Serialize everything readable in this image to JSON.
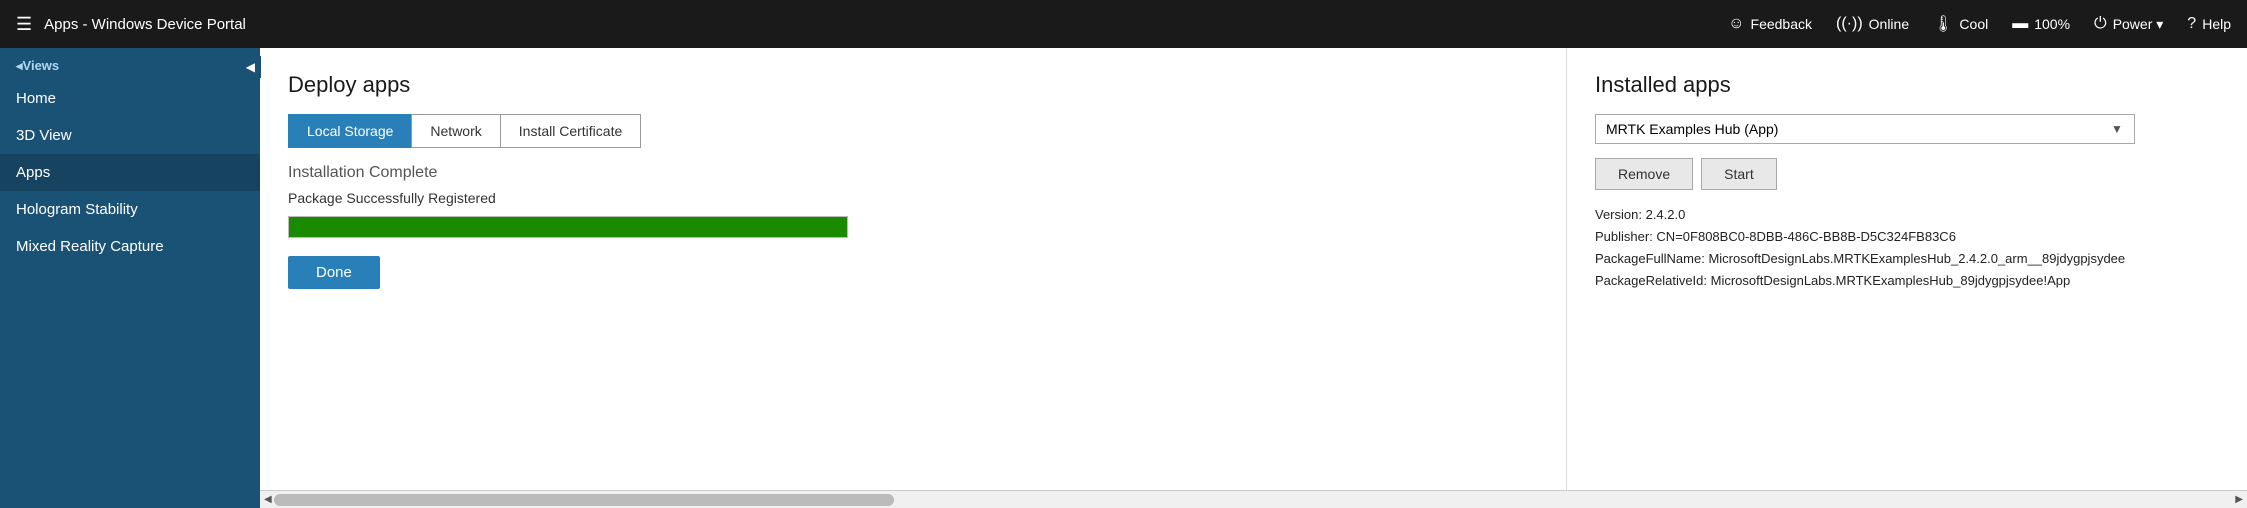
{
  "topbar": {
    "menu_icon": "☰",
    "title": "Apps - Windows Device Portal",
    "feedback_icon": "☺",
    "feedback_label": "Feedback",
    "online_icon": "((·))",
    "online_label": "Online",
    "cool_icon": "🌡",
    "cool_label": "Cool",
    "battery_icon": "🔋",
    "battery_label": "100%",
    "power_icon": "⏻",
    "power_label": "Power ▾",
    "help_icon": "?",
    "help_label": "Help"
  },
  "sidebar": {
    "collapse_icon": "◀",
    "views_header": "◂Views",
    "items": [
      {
        "label": "Home",
        "active": false
      },
      {
        "label": "3D View",
        "active": false
      },
      {
        "label": "Apps",
        "active": true
      },
      {
        "label": "Hologram Stability",
        "active": false
      },
      {
        "label": "Mixed Reality Capture",
        "active": false
      }
    ]
  },
  "deploy": {
    "title": "Deploy apps",
    "tabs": [
      {
        "label": "Local Storage",
        "active": true
      },
      {
        "label": "Network",
        "active": false
      },
      {
        "label": "Install Certificate",
        "active": false
      }
    ],
    "install_status": "Installation Complete",
    "install_substatus": "Package Successfully Registered",
    "progress_percent": 100,
    "done_button": "Done"
  },
  "installed": {
    "title": "Installed apps",
    "selected_app": "MRTK Examples Hub (App)",
    "app_options": [
      "MRTK Examples Hub (App)"
    ],
    "remove_button": "Remove",
    "start_button": "Start",
    "version_label": "Version: 2.4.2.0",
    "publisher_label": "Publisher: CN=0F808BC0-8DBB-486C-BB8B-D5C324FB83C6",
    "package_full_name": "PackageFullName: MicrosoftDesignLabs.MRTKExamplesHub_2.4.2.0_arm__89jdygpjsydee",
    "package_relative_id": "PackageRelativeId: MicrosoftDesignLabs.MRTKExamplesHub_89jdygpjsydee!App"
  },
  "scrollbar": {
    "left_arrow": "◀",
    "right_arrow": "▶"
  }
}
